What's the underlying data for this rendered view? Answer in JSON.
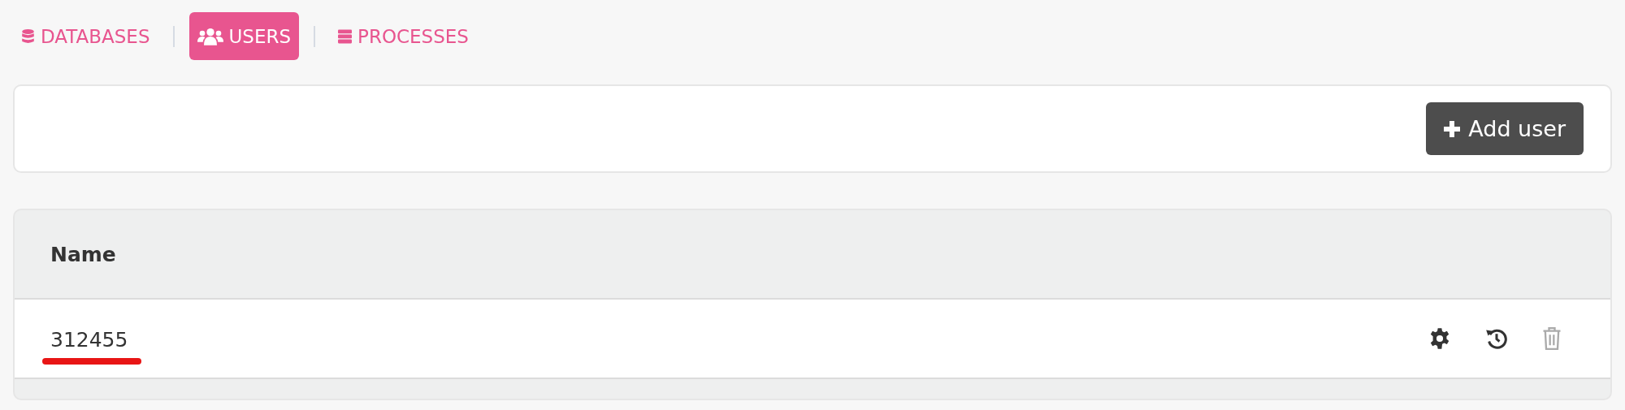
{
  "tabs": [
    {
      "label": "DATABASES",
      "kind": "database",
      "selected": false
    },
    {
      "label": "USERS",
      "kind": "users",
      "selected": true
    },
    {
      "label": "PROCESSES",
      "kind": "servers",
      "selected": false
    }
  ],
  "toolbar": {
    "button": "Add user"
  },
  "table": {
    "columns": [
      "Name"
    ],
    "rows": [
      {
        "name": "312455",
        "underlined": true,
        "actions": [
          {
            "kind": "settings",
            "disabled": false
          },
          {
            "kind": "history",
            "disabled": false
          },
          {
            "kind": "delete",
            "disabled": true
          }
        ]
      }
    ]
  }
}
